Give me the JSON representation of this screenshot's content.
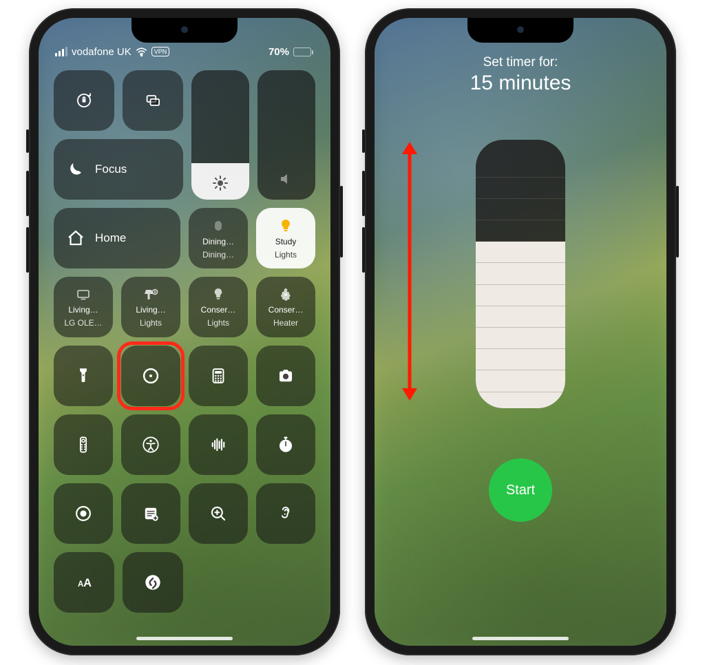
{
  "left": {
    "status": {
      "carrier": "vodafone UK",
      "vpn_badge": "VPN",
      "battery_pct": "70%"
    },
    "focus_label": "Focus",
    "home_row": {
      "home_label": "Home",
      "dining": {
        "l1": "Dining…",
        "l2": "Dining…"
      },
      "study": {
        "l1": "Study",
        "l2": "Lights"
      }
    },
    "accessory_row": {
      "living_tv": {
        "l1": "Living…",
        "l2": "LG OLE…"
      },
      "living_light": {
        "l1": "Living…",
        "l2": "Lights"
      },
      "conserv_l": {
        "l1": "Conser…",
        "l2": "Lights"
      },
      "conserv_h": {
        "l1": "Conser…",
        "l2": "Heater"
      }
    }
  },
  "right": {
    "title": "Set timer for:",
    "duration": "15 minutes",
    "start_label": "Start"
  }
}
